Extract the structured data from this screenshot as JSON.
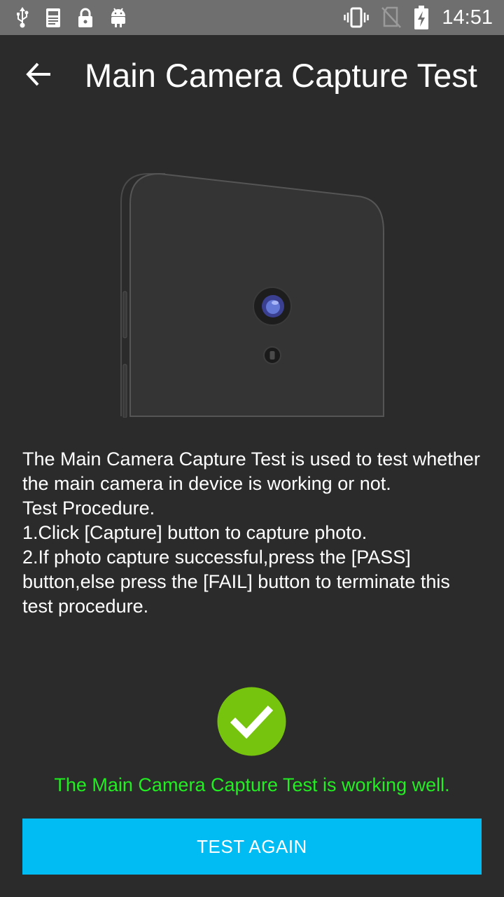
{
  "status_bar": {
    "time": "14:51",
    "left_icons": [
      "usb-icon",
      "debug-log-icon",
      "lock-icon",
      "android-icon"
    ],
    "right_icons": [
      "vibrate-icon",
      "no-sim-icon",
      "battery-charging-icon"
    ]
  },
  "app_bar": {
    "title": "Main Camera Capture Test",
    "back_icon": "arrow-back-icon"
  },
  "description": {
    "lines": [
      "The Main Camera Capture Test is used to test whether the main camera in device is working or not.",
      "Test Procedure.",
      "1.Click [Capture] button to capture photo.",
      "2.If photo capture successful,press the [PASS] button,else press the [FAIL] button to terminate this test procedure."
    ]
  },
  "result": {
    "icon": "check-circle-icon",
    "message": "The Main Camera Capture Test is working well.",
    "color": "#22ee22"
  },
  "actions": {
    "test_again_label": "TEST AGAIN",
    "button_color": "#00bcf2"
  }
}
